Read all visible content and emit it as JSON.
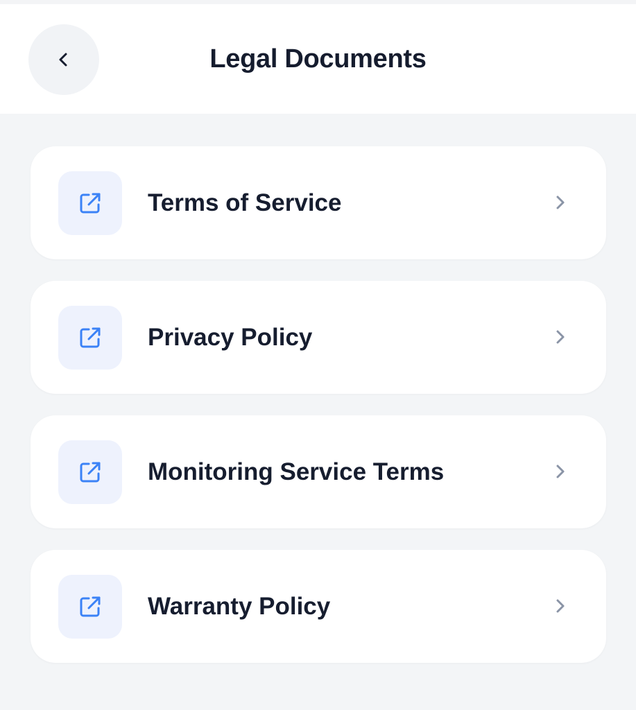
{
  "header": {
    "title": "Legal Documents",
    "back_icon": "chevron-left-icon"
  },
  "items": [
    {
      "label": "Terms of Service",
      "icon": "external-link-icon"
    },
    {
      "label": "Privacy Policy",
      "icon": "external-link-icon"
    },
    {
      "label": "Monitoring Service Terms",
      "icon": "external-link-icon"
    },
    {
      "label": "Warranty Policy",
      "icon": "external-link-icon"
    }
  ],
  "colors": {
    "background": "#f3f5f7",
    "card": "#ffffff",
    "accent": "#3b82f6",
    "icon_bg": "#eef2fd",
    "text": "#161d2f",
    "chevron": "#8a94a6"
  }
}
